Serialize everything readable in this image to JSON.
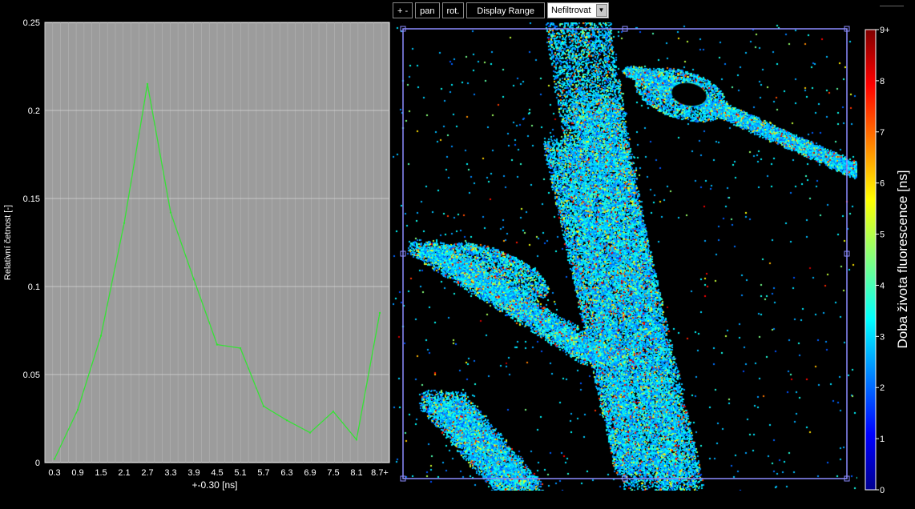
{
  "toolbar": {
    "zoom_label": "+ -",
    "pan_label": "pan",
    "rot_label": "rot.",
    "range_label": "Display Range",
    "filter_value": "Nefiltrovat"
  },
  "colors": {
    "plot_bg": "#9c9c9c",
    "line": "#35e335",
    "grid": "#d0d0d0",
    "roi": "#8c8cff"
  },
  "chart_data": {
    "type": "line",
    "ylabel": "Relativní četnost [-]",
    "xlabel": "+-0.30 [ns]",
    "xticks": [
      "0.3",
      "0.9",
      "1.5",
      "2.1",
      "2.7",
      "3.3",
      "3.9",
      "4.5",
      "5.1",
      "5.7",
      "6.3",
      "6.9",
      "7.5",
      "8.1",
      "8.7+"
    ],
    "yticks": [
      "0",
      "0.05",
      "0.1",
      "0.15",
      "0.2",
      "0.25"
    ],
    "ylim": [
      0,
      0.25
    ],
    "x": [
      0.3,
      0.9,
      1.5,
      2.1,
      2.7,
      3.3,
      3.9,
      4.5,
      5.1,
      5.7,
      6.3,
      6.9,
      7.5,
      8.1,
      8.7
    ],
    "values": [
      0.002,
      0.03,
      0.072,
      0.136,
      0.215,
      0.142,
      0.104,
      0.067,
      0.065,
      0.032,
      0.024,
      0.017,
      0.029,
      0.013,
      0.085
    ],
    "colorbar": {
      "label": "Doba života fluorescence [ns]",
      "ticks": [
        "0",
        "1",
        "2",
        "3",
        "4",
        "5",
        "6",
        "7",
        "8",
        "9+"
      ],
      "range": [
        0,
        9
      ]
    }
  }
}
